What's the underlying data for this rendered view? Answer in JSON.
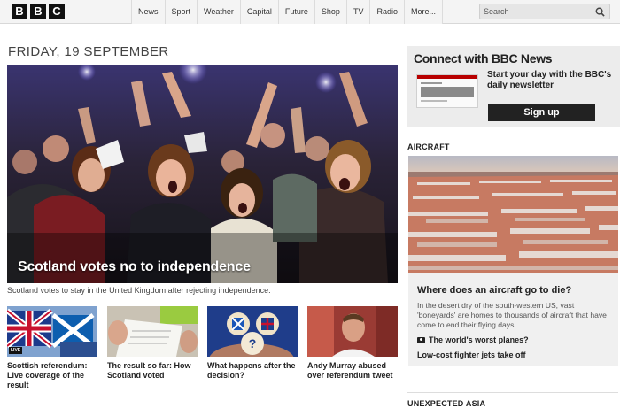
{
  "logo": {
    "letters": [
      "B",
      "B",
      "C"
    ]
  },
  "nav": {
    "items": [
      "News",
      "Sport",
      "Weather",
      "Capital",
      "Future",
      "Shop",
      "TV",
      "Radio",
      "More..."
    ]
  },
  "search": {
    "placeholder": "Search",
    "icon": "search-icon"
  },
  "date_heading": "FRIDAY, 19 SEPTEMBER",
  "hero": {
    "headline": "Scotland votes no to independence",
    "caption": "Scotland votes to stay in the United Kingdom after rejecting independence."
  },
  "stories": [
    {
      "title": "Scottish referendum: Live coverage of the result",
      "badge": "LIVE"
    },
    {
      "title": "The result so far: How Scotland voted"
    },
    {
      "title": "What happens after the decision?"
    },
    {
      "title": "Andy Murray abused over referendum tweet"
    }
  ],
  "connect": {
    "title": "Connect with BBC News",
    "text": "Start your day with the BBC's daily newsletter",
    "button": "Sign up"
  },
  "aircraft": {
    "section": "AIRCRAFT",
    "title": "Where does an aircraft go to die?",
    "description": "In the desert dry of the south-western US, vast 'boneyards' are homes to thousands of aircraft that have come to end their flying days.",
    "link1": "The world's worst planes?",
    "link2": "Low-cost fighter jets take off"
  },
  "next_section": "UNEXPECTED ASIA",
  "colors": {
    "topbar": "#f4f4f4",
    "logo_box": "#111111",
    "signup": "#222222"
  }
}
